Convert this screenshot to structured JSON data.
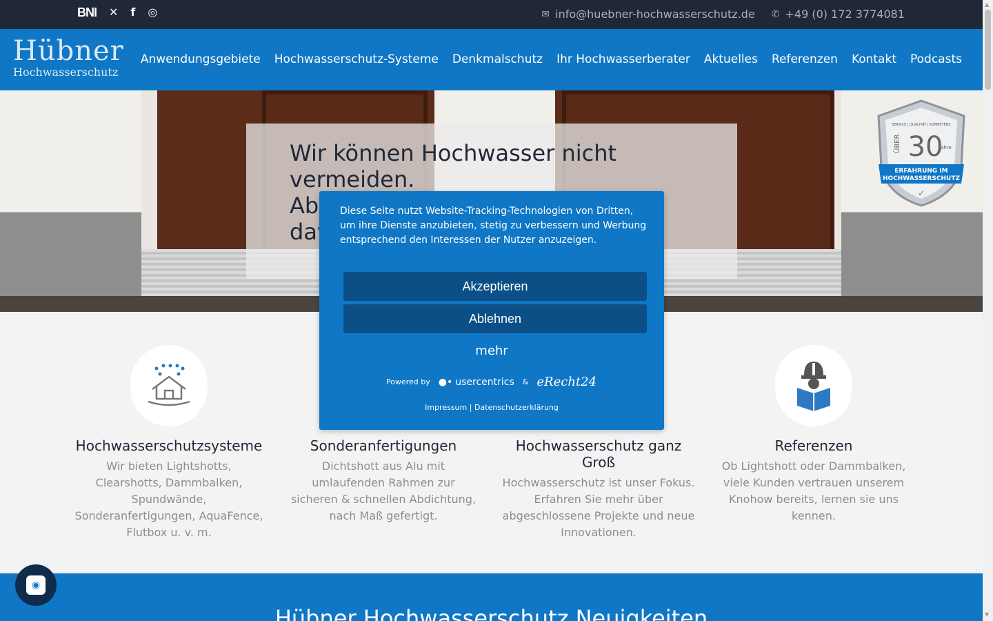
{
  "topbar": {
    "social": [
      {
        "name": "bni",
        "label": "BNI"
      },
      {
        "name": "xing",
        "label": "✕"
      },
      {
        "name": "facebook",
        "label": "f"
      },
      {
        "name": "instagram",
        "label": "◎"
      }
    ],
    "email": "info@huebner-hochwasserschutz.de",
    "phone": "+49 (0) 172 3774081"
  },
  "logo": {
    "line1": "Hübner",
    "line2": "Hochwasserschutz"
  },
  "nav": [
    "Anwendungsgebiete",
    "Hochwasserschutz-Systeme",
    "Denkmalschutz",
    "Ihr Hochwasserberater",
    "Aktuelles",
    "Referenzen",
    "Kontakt",
    "Podcasts"
  ],
  "hero": {
    "line1": "Wir können Hochwasser nicht",
    "line2": "vermeiden.",
    "line3": "Abe",
    "line4": "dav"
  },
  "badge": {
    "top": "SERVICE | QUALITÄT | KOMPETENZ",
    "uber": "ÜBER",
    "number": "30",
    "jahre": "Jahre",
    "ribbon1": "ERFAHRUNG IM",
    "ribbon2": "HOCHWASSERSCHUTZ"
  },
  "features": [
    {
      "title": "Hochwasserschutzsysteme",
      "text": "Wir bieten Lightshotts, Clearshotts, Dammbalken, Spundwände, Sonderanfertigungen, AquaFence, Flutbox u. v. m.",
      "icon": "flood-house-icon"
    },
    {
      "title": "Sonderanfertigungen",
      "text": "Dichtshott aus Alu mit umlaufenden Rahmen zur sicheren & schnellen Abdichtung, nach Maß gefertigt.",
      "icon": "custom-icon"
    },
    {
      "title": "Hochwasserschutz ganz Groß",
      "text": "Hochwasserschutz ist unser Fokus. Erfahren Sie mehr über abgeschlossene Projekte und neue Innovationen.",
      "icon": "large-scale-icon"
    },
    {
      "title": "Referenzen",
      "text": "Ob Lightshott oder Dammbalken, viele Kunden vertrauen unserem Knohow bereits, lernen sie uns kennen.",
      "icon": "worker-book-icon"
    }
  ],
  "news": {
    "title": "Hübner Hochwasserschutz Neuigkeiten"
  },
  "cookie": {
    "message": "Diese Seite nutzt Website-Tracking-Technologien von Dritten, um ihre Dienste anzubieten, stetig zu verbessern und Werbung entsprechend den Interessen der Nutzer anzuzeigen.",
    "accept": "Akzeptieren",
    "decline": "Ablehnen",
    "more": "mehr",
    "powered_by": "Powered by",
    "usercentrics": "usercentrics",
    "and": "&",
    "erecht": "eRecht24",
    "impressum": "Impressum",
    "separator": "|",
    "privacy": "Datenschutzerklärung"
  },
  "colors": {
    "topbar": "#202838",
    "brand_blue": "#0f77c6",
    "button_dark": "#0b4f86",
    "background": "#f3f3f3"
  }
}
